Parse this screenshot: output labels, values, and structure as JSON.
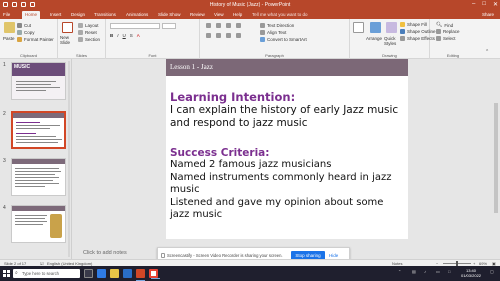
{
  "window": {
    "title": "History of Music (Jazz) - PowerPoint",
    "min": "–",
    "max": "□",
    "close": "✕"
  },
  "tabs": [
    "File",
    "Home",
    "Insert",
    "Design",
    "Transitions",
    "Animations",
    "Slide Show",
    "Review",
    "View",
    "Help",
    "Tell me what you want to do"
  ],
  "share_label": "Share",
  "ribbon": {
    "clipboard": {
      "paste": "Paste",
      "cut": "Cut",
      "copy": "Copy",
      "format_painter": "Format Painter",
      "label": "Clipboard"
    },
    "slides": {
      "new_slide": "New Slide",
      "layout": "Layout",
      "reset": "Reset",
      "section": "Section",
      "label": "Slides"
    },
    "font": {
      "label": "Font"
    },
    "paragraph": {
      "label": "Paragraph",
      "text_direction": "Text Direction",
      "align_text": "Align Text",
      "smartart": "Convert to SmartArt"
    },
    "drawing": {
      "arrange": "Arrange",
      "quick_styles": "Quick Styles",
      "shape_fill": "Shape Fill",
      "shape_outline": "Shape Outline",
      "shape_effects": "Shape Effects",
      "label": "Drawing"
    },
    "editing": {
      "find": "Find",
      "replace": "Replace",
      "select": "Select",
      "label": "Editing"
    }
  },
  "thumbnails": [
    {
      "num": "1",
      "title": "MUSIC"
    },
    {
      "num": "2",
      "title": "Learning Intention"
    },
    {
      "num": "3",
      "title": ""
    },
    {
      "num": "4",
      "title": ""
    }
  ],
  "slide": {
    "header": "Lesson 1 - Jazz",
    "li_heading": "Learning Intention:",
    "li_body": "I can explain the history of early Jazz music and respond to jazz music",
    "sc_heading": "Success Criteria:",
    "sc_items": [
      "Named 2 famous jazz musicians",
      "Named instruments commonly heard in jazz music",
      "Listened and gave my opinion about some jazz music"
    ]
  },
  "notes_hint": "Click to add notes",
  "banner": {
    "text": "Screencastify - Screen Video Recorder is sharing your screen.",
    "stop": "Stop sharing",
    "hide": "Hide"
  },
  "status": {
    "slide": "Slide 2 of 17",
    "language": "English (United Kingdom)",
    "notes": "Notes",
    "zoom": "69%"
  },
  "taskbar": {
    "search_placeholder": "Type here to search",
    "time": "13:40",
    "date": "01/03/2022"
  },
  "colors": {
    "accent": "#b7472a",
    "header_bar": "#7c6877",
    "heading_purple": "#7b2f8f"
  }
}
